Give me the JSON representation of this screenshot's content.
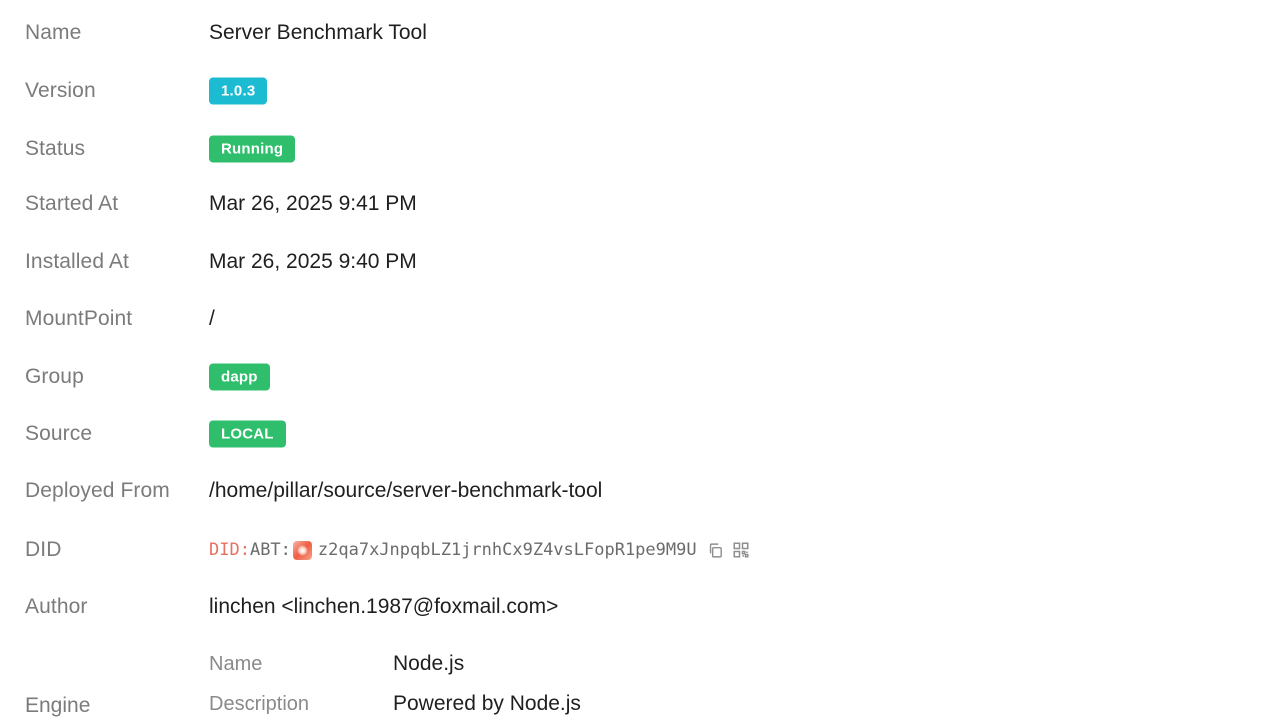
{
  "fields": {
    "name": {
      "label": "Name",
      "value": "Server Benchmark Tool"
    },
    "version": {
      "label": "Version",
      "value": "1.0.3",
      "color": "#1bbcd2"
    },
    "status": {
      "label": "Status",
      "value": "Running",
      "color": "#2fbf6c"
    },
    "started_at": {
      "label": "Started At",
      "value": "Mar 26, 2025 9:41 PM"
    },
    "installed_at": {
      "label": "Installed At",
      "value": "Mar 26, 2025 9:40 PM"
    },
    "mountpoint": {
      "label": "MountPoint",
      "value": "/"
    },
    "group": {
      "label": "Group",
      "value": "dapp",
      "color": "#2fbf6c"
    },
    "source": {
      "label": "Source",
      "value": "LOCAL",
      "color": "#2fbf6c"
    },
    "deployed_from": {
      "label": "Deployed From",
      "value": "/home/pillar/source/server-benchmark-tool"
    },
    "did": {
      "label": "DID",
      "prefix": "DID:",
      "method": "ABT:",
      "address": "z2qa7xJnpqbLZ1jrnhCx9Z4vsLFopR1pe9M9U",
      "avatar_icon": "did-avatar-icon",
      "copy_icon": "copy-icon",
      "qr_icon": "qrcode-icon"
    },
    "author": {
      "label": "Author",
      "value": "linchen <linchen.1987@foxmail.com>"
    },
    "engine": {
      "label": "Engine",
      "name_label": "Name",
      "name_value": "Node.js",
      "description_label": "Description",
      "description_value": "Powered by Node.js"
    }
  }
}
